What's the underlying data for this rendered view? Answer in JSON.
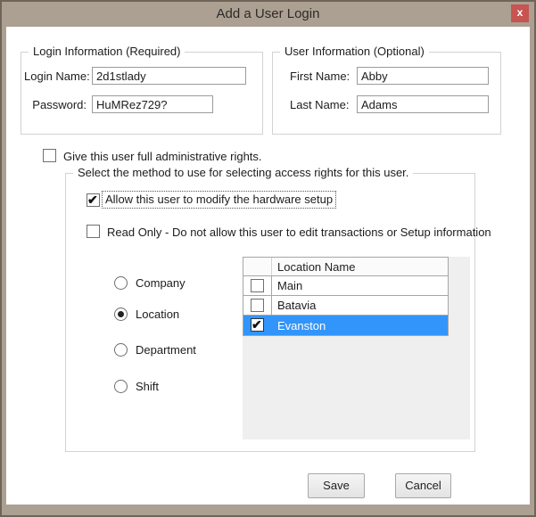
{
  "window": {
    "title": "Add a User Login",
    "close_label": "x"
  },
  "login_group": {
    "title": "Login Information (Required)",
    "login_name_label": "Login Name:",
    "login_name_value": "2d1stlady",
    "password_label": "Password:",
    "password_value": "HuMRez729?"
  },
  "user_group": {
    "title": "User Information (Optional)",
    "first_name_label": "First Name:",
    "first_name_value": "Abby",
    "last_name_label": "Last Name:",
    "last_name_value": "Adams"
  },
  "admin_checkbox": {
    "label": "Give this user full administrative rights.",
    "checked": false
  },
  "access_group": {
    "title": "Select the method to use for selecting access rights for this user.",
    "hardware_checkbox": {
      "label": "Allow this user to modify the hardware setup",
      "checked": true
    },
    "readonly_checkbox": {
      "label": "Read Only - Do not allow this user to edit transactions or Setup information",
      "checked": false
    },
    "method_options": [
      {
        "label": "Company",
        "selected": false
      },
      {
        "label": "Location",
        "selected": true
      },
      {
        "label": "Department",
        "selected": false
      },
      {
        "label": "Shift",
        "selected": false
      }
    ],
    "location_table": {
      "header": "Location Name",
      "rows": [
        {
          "name": "Main",
          "checked": false,
          "selected": false
        },
        {
          "name": "Batavia",
          "checked": false,
          "selected": false
        },
        {
          "name": "Evanston",
          "checked": true,
          "selected": true
        }
      ]
    }
  },
  "buttons": {
    "save": "Save",
    "cancel": "Cancel"
  },
  "colors": {
    "titlebar": "#aca093",
    "close_button": "#c75450",
    "selected_row": "#3295fb"
  }
}
